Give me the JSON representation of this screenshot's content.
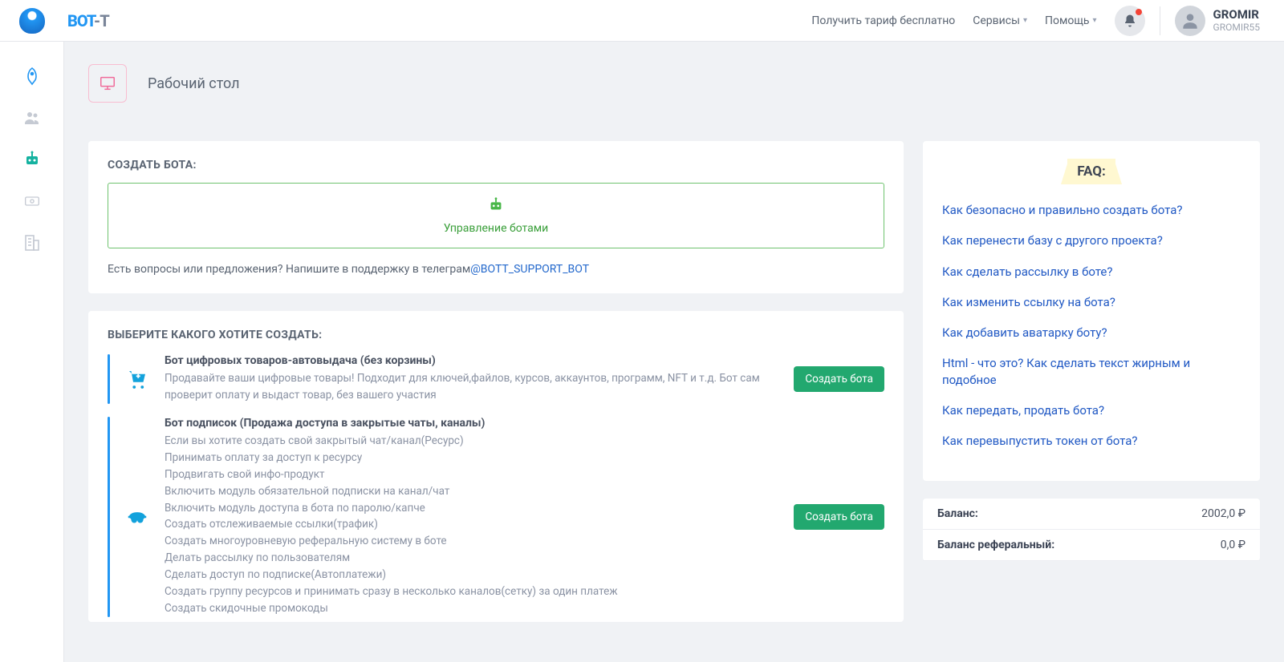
{
  "header": {
    "logo_main": "BOT",
    "logo_suffix": "-T",
    "links": {
      "tariff": "Получить тариф бесплатно",
      "services": "Сервисы",
      "help": "Помощь"
    },
    "user": {
      "name": "GROMIR",
      "sub": "GROMIR55"
    }
  },
  "page": {
    "title": "Рабочий стол"
  },
  "create_bot": {
    "heading": "СОЗДАТЬ БОТА:",
    "manage_label": "Управление ботами",
    "support_text": "Есть вопросы или предложения? Напишите в поддержку в телеграм",
    "support_link": "@BOTT_SUPPORT_BOT"
  },
  "choose": {
    "heading": "ВЫБЕРИТЕ КАКОГО ХОТИТЕ СОЗДАТЬ:",
    "create_label": "Создать бота",
    "options": [
      {
        "title": "Бот цифровых товаров-автовыдача (без корзины)",
        "desc": "Продавайте ваши цифровые товары! Подходит для ключей,файлов, курсов, аккаунтов, программ, NFT и т.д. Бот сам проверит оплату и выдаст товар, без вашего участия"
      },
      {
        "title": "Бот подписок (Продажа доступа в закрытые чаты, каналы)",
        "desc": "Если вы хотите создать свой закрытый чат/канал(Ресурс)\nПринимать оплату за доступ к ресурсу\nПродвигать свой инфо-продукт\nВключить модуль обязательной подписки на канал/чат\nВключить модуль доступа в бота по паролю/капче\nСоздать отслеживаемые ссылки(трафик)\nСоздать многоуровневую реферальную систему в боте\nДелать рассылку по пользователям\nСделать доступ по подписке(Автоплатежи)\nСоздать группу ресурсов и принимать сразу в несколько каналов(сетку) за один платеж\nСоздать скидочные промокоды"
      }
    ]
  },
  "faq": {
    "heading": "FAQ:",
    "items": [
      "Как безопасно и правильно создать бота?",
      "Как перенести базу с другого проекта?",
      "Как сделать рассылку в боте?",
      "Как изменить ссылку на бота?",
      "Как добавить аватарку боту?",
      "Html - что это? Как сделать текст жирным и подобное",
      "Как передать, продать бота?",
      "Как перевыпустить токен от бота?"
    ]
  },
  "balance": {
    "rows": [
      {
        "label": "Баланс:",
        "value": "2002,0 ₽"
      },
      {
        "label": "Баланс реферальный:",
        "value": "0,0 ₽"
      }
    ]
  }
}
